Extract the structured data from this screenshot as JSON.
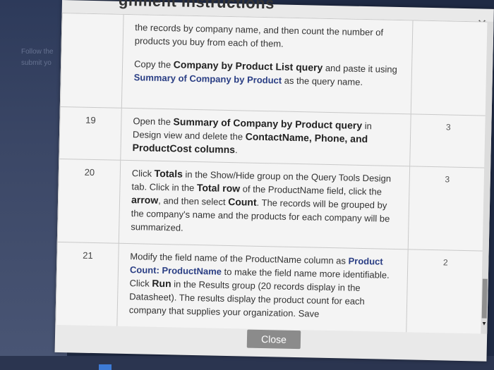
{
  "background": {
    "ghost_text_1": "Follow the",
    "ghost_text_2": "submit yo"
  },
  "dialog": {
    "title": "gnment Instructions",
    "close_icon": "×",
    "close_button_label": "Close",
    "accent_color": "#2a3e84",
    "rows": [
      {
        "step": "",
        "points": "",
        "paragraphs": [
          {
            "parts": [
              {
                "t": "the records by company name, and then count the number of products you buy from each of them."
              }
            ]
          },
          {
            "parts": [
              {
                "t": "Copy the "
              },
              {
                "t": "Company by Product List query",
                "s": "b"
              },
              {
                "t": " and paste it using "
              },
              {
                "t": "Summary of Company by Product",
                "s": "blue"
              },
              {
                "t": " as the query name."
              }
            ]
          }
        ]
      },
      {
        "step": "19",
        "points": "3",
        "paragraphs": [
          {
            "parts": [
              {
                "t": "Open the "
              },
              {
                "t": "Summary of Company by Product query",
                "s": "b"
              },
              {
                "t": " in Design view and delete the "
              },
              {
                "t": "ContactName, Phone, and ProductCost columns",
                "s": "b"
              },
              {
                "t": "."
              }
            ]
          }
        ]
      },
      {
        "step": "20",
        "points": "3",
        "paragraphs": [
          {
            "parts": [
              {
                "t": "Click "
              },
              {
                "t": "Totals",
                "s": "b"
              },
              {
                "t": " in the Show/Hide group on the Query Tools Design tab. Click in the "
              },
              {
                "t": "Total row",
                "s": "b"
              },
              {
                "t": " of the ProductName field, click the "
              },
              {
                "t": "arrow",
                "s": "b"
              },
              {
                "t": ", and then select "
              },
              {
                "t": "Count",
                "s": "b"
              },
              {
                "t": ". The records will be grouped by the company's name and the products for each company will be summarized."
              }
            ]
          }
        ]
      },
      {
        "step": "21",
        "points": "2",
        "paragraphs": [
          {
            "parts": [
              {
                "t": "Modify the field name of the ProductName column as "
              },
              {
                "t": "Product Count: ProductName",
                "s": "blue"
              },
              {
                "t": " to make the field name more identifiable. Click "
              },
              {
                "t": "Run",
                "s": "b"
              },
              {
                "t": " in the Results group (20 records display in the Datasheet). The results display the product count for each company that supplies your organization. Save"
              }
            ]
          }
        ]
      }
    ]
  }
}
